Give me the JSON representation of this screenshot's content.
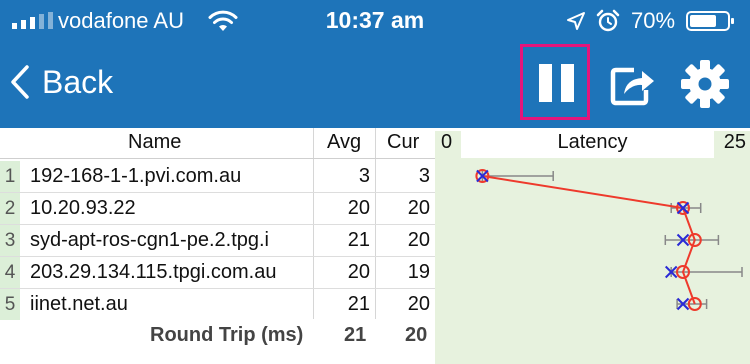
{
  "status_bar": {
    "carrier": "vodafone AU",
    "time": "10:37 am",
    "battery": "70%",
    "icons": [
      "signal-icon",
      "wifi-icon",
      "location-arrow-icon",
      "alarm-icon",
      "battery-icon"
    ]
  },
  "nav": {
    "back_label": "Back",
    "buttons": [
      "pause-icon",
      "share-icon",
      "gear-icon"
    ],
    "highlight_color": "#e5157b",
    "bar_color": "#1e74b9"
  },
  "table": {
    "headers": {
      "name": "Name",
      "avg": "Avg",
      "cur": "Cur"
    },
    "rows": [
      {
        "idx": "1",
        "name": "192-168-1-1.pvi.com.au",
        "avg": "3",
        "cur": "3",
        "min": 3,
        "max": 9,
        "avg_ms": 3,
        "cur_ms": 3
      },
      {
        "idx": "2",
        "name": "10.20.93.22",
        "avg": "20",
        "cur": "20",
        "min": 19,
        "max": 21.5,
        "avg_ms": 20,
        "cur_ms": 20
      },
      {
        "idx": "3",
        "name": "syd-apt-ros-cgn1-pe.2.tpg.i",
        "avg": "21",
        "cur": "20",
        "min": 18.5,
        "max": 23,
        "avg_ms": 21,
        "cur_ms": 20
      },
      {
        "idx": "4",
        "name": "203.29.134.115.tpgi.com.au",
        "avg": "20",
        "cur": "19",
        "min": 19,
        "max": 25,
        "avg_ms": 20,
        "cur_ms": 19
      },
      {
        "idx": "5",
        "name": "iinet.net.au",
        "avg": "21",
        "cur": "20",
        "min": 19.5,
        "max": 22,
        "avg_ms": 21,
        "cur_ms": 20
      }
    ],
    "footer": {
      "label": "Round Trip (ms)",
      "avg": "21",
      "cur": "20"
    }
  },
  "latency": {
    "title": "Latency",
    "min_label": "0",
    "max_label": "25",
    "range": [
      0,
      25
    ],
    "colors": {
      "avg_line": "#ee3a2c",
      "cur_marker": "#2a2ad6",
      "whisker": "#888888",
      "panel": "#e7f2de"
    }
  }
}
